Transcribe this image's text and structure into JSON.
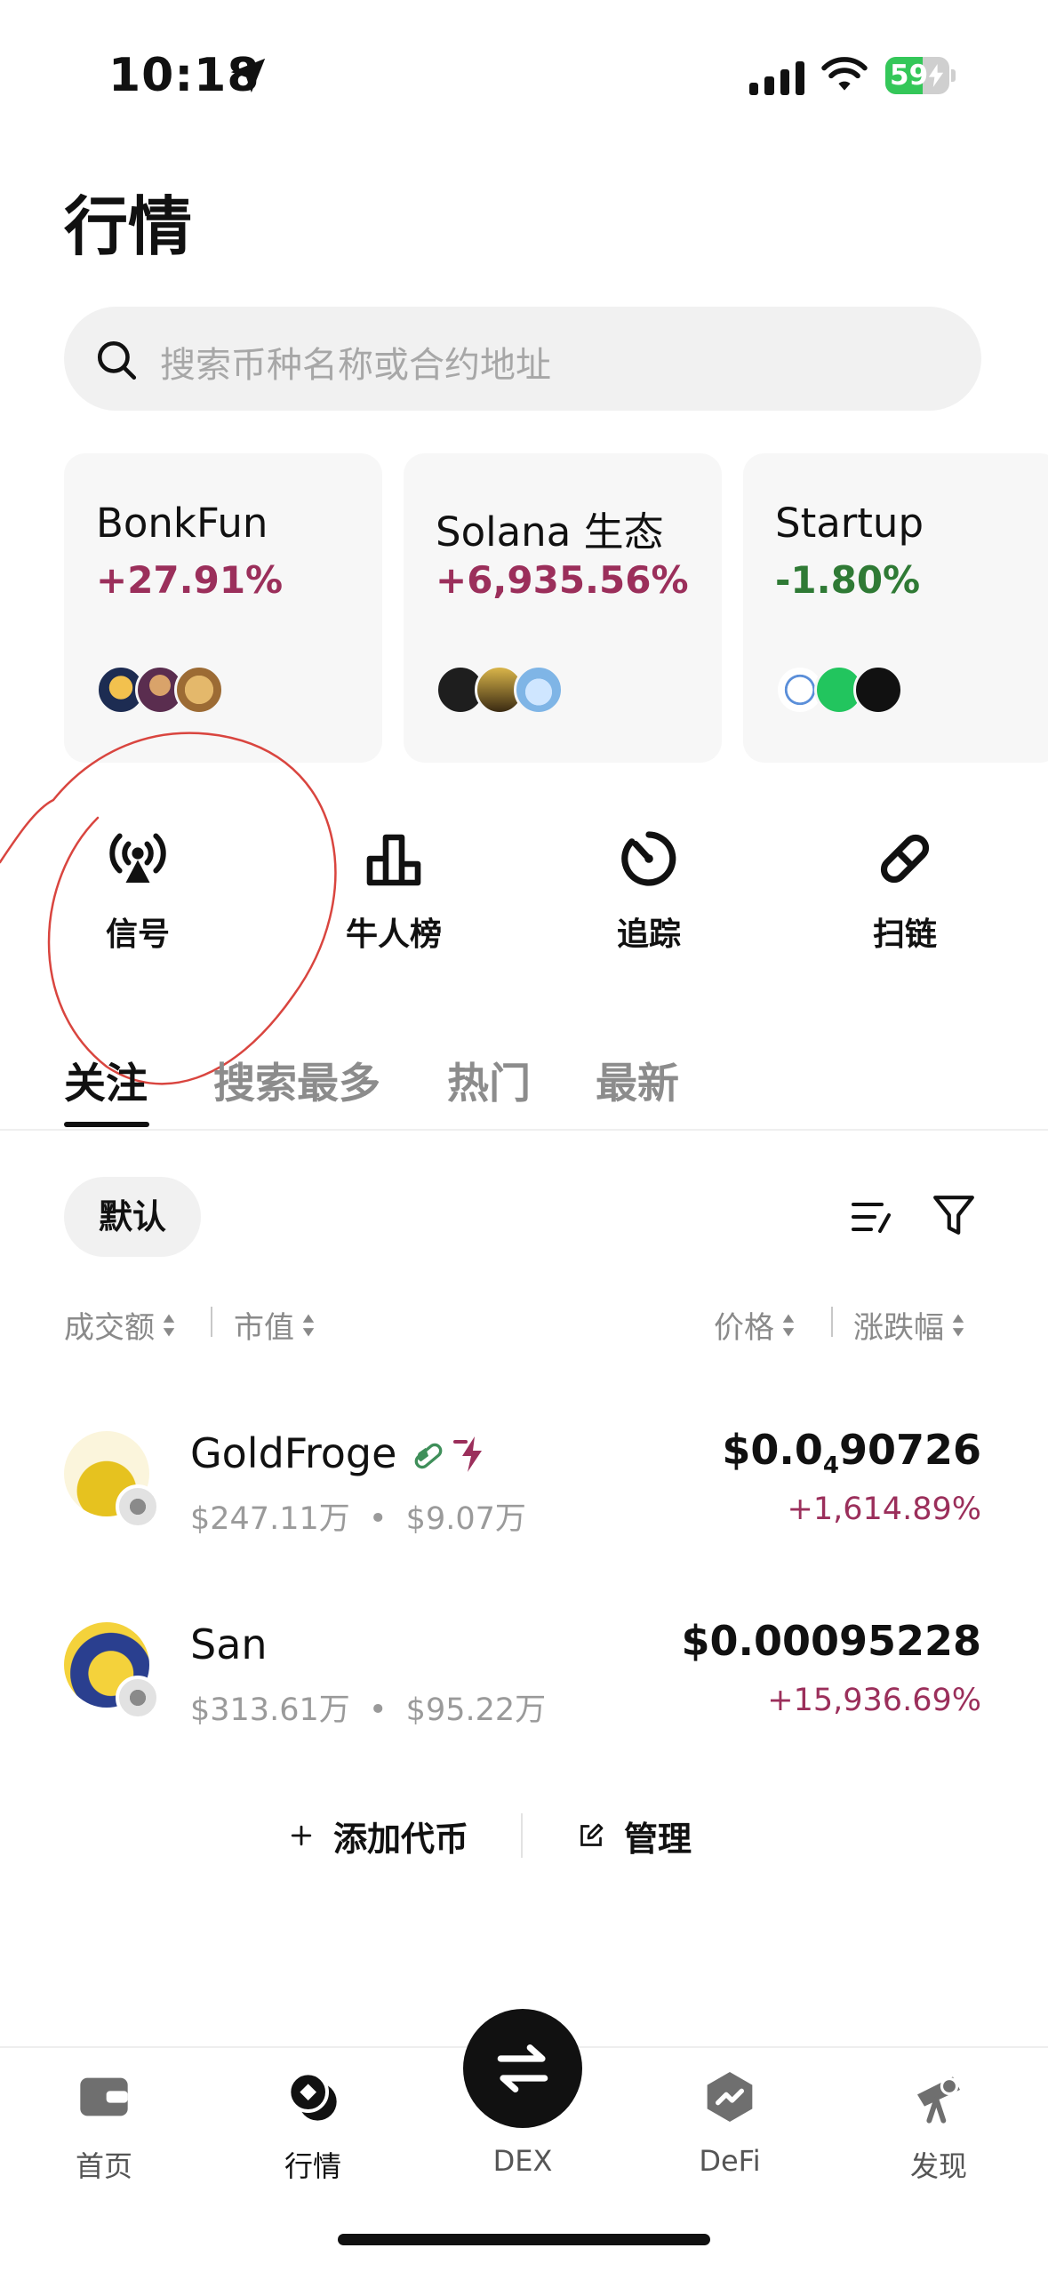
{
  "status_bar": {
    "time": "10:18",
    "battery": "59"
  },
  "page_title": "行情",
  "search": {
    "placeholder": "搜索币种名称或合约地址"
  },
  "sectors": [
    {
      "name": "BonkFun",
      "change": "+27.91%"
    },
    {
      "name": "Solana 生态",
      "change": "+6,935.56%"
    },
    {
      "name": "Startup",
      "change": "-1.80%"
    }
  ],
  "quick_actions": [
    {
      "label": "信号",
      "icon": "signal-broadcast-icon"
    },
    {
      "label": "牛人榜",
      "icon": "leaderboard-icon"
    },
    {
      "label": "追踪",
      "icon": "tracking-icon"
    },
    {
      "label": "扫链",
      "icon": "chain-link-icon"
    }
  ],
  "tabs": [
    "关注",
    "搜索最多",
    "热门",
    "最新"
  ],
  "filter": {
    "chip": "默认"
  },
  "columns": {
    "volume": "成交额",
    "market_cap": "市值",
    "price": "价格",
    "change": "涨跌幅"
  },
  "tokens": [
    {
      "name": "GoldFroge",
      "volume": "$247.11万",
      "market_cap": "$9.07万",
      "price_main": "$0.0",
      "price_sub": "4",
      "price_tail": "90726",
      "change": "+1,614.89%"
    },
    {
      "name": "San",
      "volume": "$313.61万",
      "market_cap": "$95.22万",
      "price": "$0.00095228",
      "change": "+15,936.69%"
    }
  ],
  "actions": {
    "add": "添加代币",
    "manage": "管理"
  },
  "nav": [
    {
      "label": "首页"
    },
    {
      "label": "行情"
    },
    {
      "label": "DEX"
    },
    {
      "label": "DeFi"
    },
    {
      "label": "发现"
    }
  ],
  "colors": {
    "up": "#9b2f5b",
    "down": "#2f7a35",
    "battery": "#34c759"
  }
}
